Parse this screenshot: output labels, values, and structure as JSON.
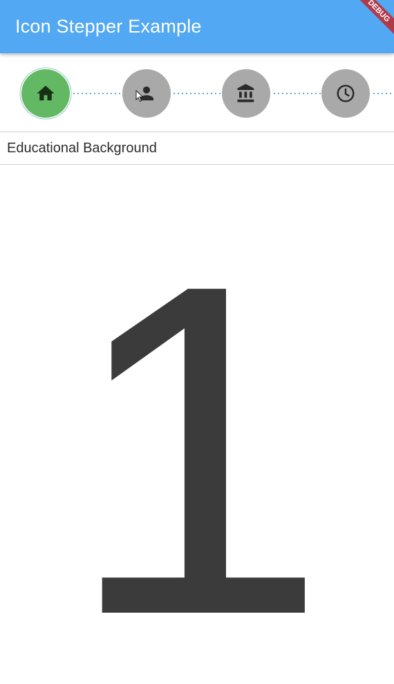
{
  "appbar": {
    "title": "Icon Stepper Example",
    "background_color": "#52a8f3",
    "debug_banner": "DEBUG"
  },
  "stepper": {
    "active_index": 0,
    "active_color": "#63b963",
    "inactive_color": "#a9a9a9",
    "connector_color": "#5aa7d6",
    "steps": [
      {
        "icon": "home-icon",
        "active": true
      },
      {
        "icon": "person-icon",
        "active": false
      },
      {
        "icon": "bank-icon",
        "active": false
      },
      {
        "icon": "clock-icon",
        "active": false
      }
    ]
  },
  "content": {
    "header": "Educational Background",
    "number": "1",
    "number_color": "#3b3b3b"
  }
}
